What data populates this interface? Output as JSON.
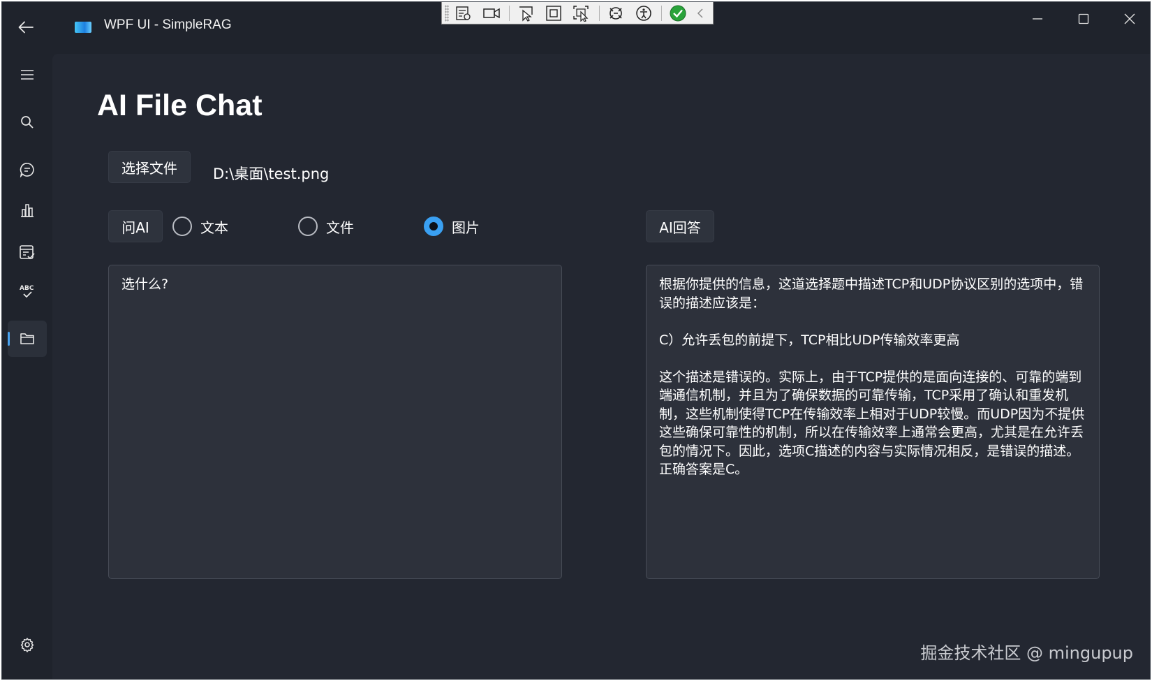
{
  "window": {
    "title": "WPF UI - SimpleRAG"
  },
  "page": {
    "title": "AI File Chat"
  },
  "file": {
    "select_button": "选择文件",
    "path": "D:\\桌面\\test.png"
  },
  "ask": {
    "button": "问AI",
    "options": [
      {
        "label": "文本",
        "checked": false
      },
      {
        "label": "文件",
        "checked": false
      },
      {
        "label": "图片",
        "checked": true
      }
    ],
    "input_value": "选什么?"
  },
  "answer": {
    "button": "AI回答",
    "text": "根据你提供的信息，这道选择题中描述TCP和UDP协议区别的选项中，错误的描述应该是：\n\nC）允许丢包的前提下，TCP相比UDP传输效率更高\n\n这个描述是错误的。实际上，由于TCP提供的是面向连接的、可靠的端到端通信机制，并且为了确保数据的可靠传输，TCP采用了确认和重发机制，这些机制使得TCP在传输效率上相对于UDP较慢。而UDP因为不提供这些确保可靠性的机制，所以在传输效率上通常会更高，尤其是在允许丢包的情况下。因此，选项C描述的内容与实际情况相反，是错误的描述。正确答案是C。"
  },
  "sidebar": {
    "items": [
      {
        "icon": "hamburger-menu-icon"
      },
      {
        "icon": "search-icon"
      },
      {
        "icon": "chat-bubble-icon"
      },
      {
        "icon": "bar-chart-icon"
      },
      {
        "icon": "form-checklist-icon"
      },
      {
        "icon": "spellcheck-abc-icon"
      },
      {
        "icon": "folder-icon",
        "active": true
      },
      {
        "icon": "gear-icon"
      }
    ]
  },
  "watermark": "掘金技术社区 @ mingupup",
  "colors": {
    "background": "#1f232c",
    "content": "#232731",
    "accent": "#3aa0f2",
    "textbox": "#2d313b"
  }
}
